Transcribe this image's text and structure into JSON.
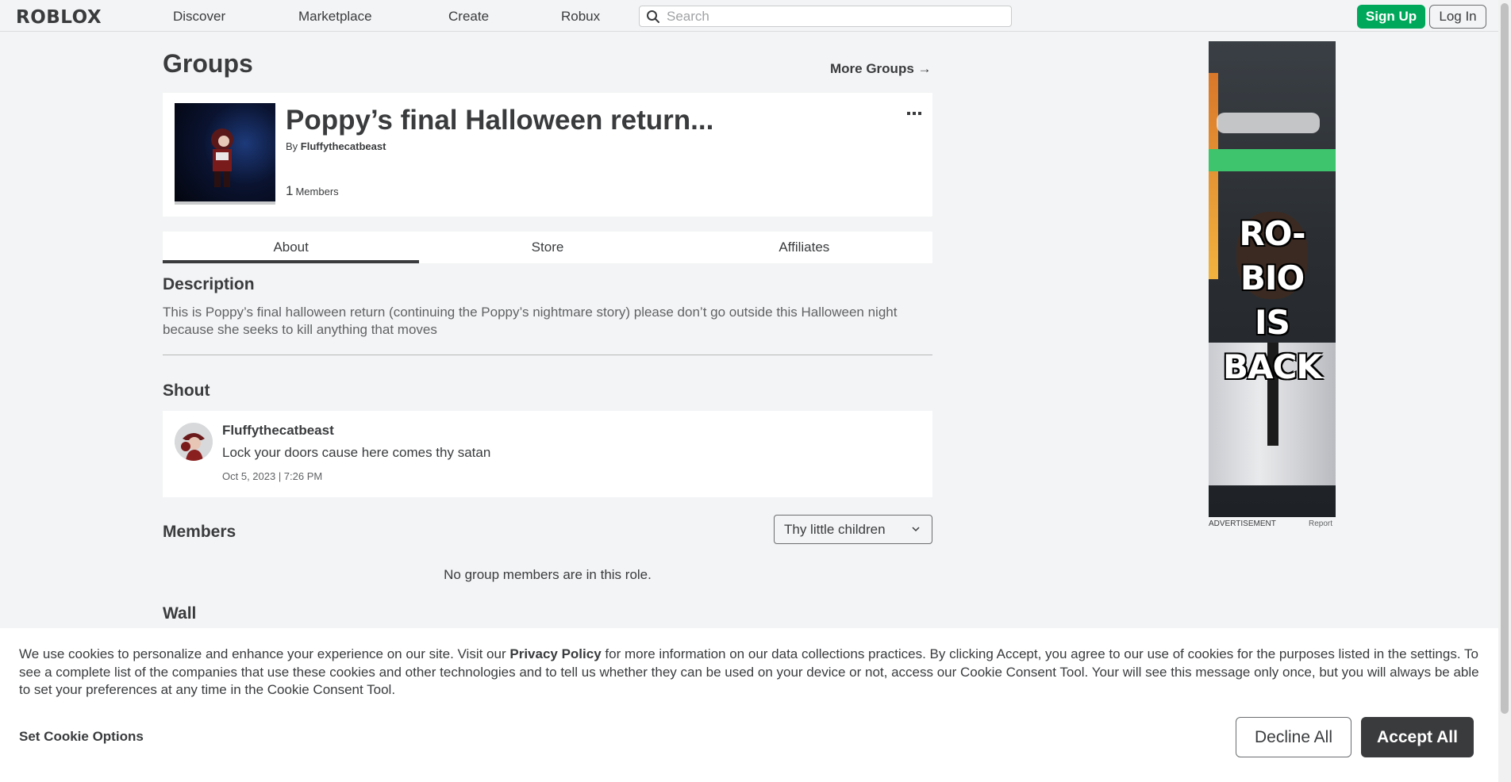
{
  "header": {
    "logo": "RΟBLOX",
    "nav": [
      "Discover",
      "Marketplace",
      "Create",
      "Robux"
    ],
    "search_placeholder": "Search",
    "signup_label": "Sign Up",
    "login_label": "Log In"
  },
  "page": {
    "title": "Groups",
    "more_groups": "More Groups →"
  },
  "group": {
    "name": "Poppy’s final Halloween return...",
    "by_prefix": "By",
    "owner": "Fluffythecatbeast",
    "member_count": "1",
    "member_label": "Members"
  },
  "tabs": [
    {
      "label": "About",
      "active": true
    },
    {
      "label": "Store",
      "active": false
    },
    {
      "label": "Affiliates",
      "active": false
    }
  ],
  "about": {
    "description_heading": "Description",
    "description": "This is Poppy’s final halloween return (continuing the Poppy’s nightmare story) please don’t go outside this Halloween night because she seeks to kill anything that moves",
    "shout_heading": "Shout",
    "shout": {
      "user": "Fluffythecatbeast",
      "text": "Lock your doors cause here comes thy satan",
      "time": "Oct 5, 2023 | 7:26 PM"
    },
    "members_heading": "Members",
    "role_selected": "Thy little children",
    "no_members": "No group members are in this role.",
    "wall_heading": "Wall"
  },
  "ad": {
    "headline_lines": [
      "RO-BIO",
      "IS",
      "BACK"
    ],
    "label": "ADVERTISEMENT",
    "report": "Report"
  },
  "cookie": {
    "text_before_link": "We use cookies to personalize and enhance your experience on our site. Visit our ",
    "link": "Privacy Policy",
    "text_after_link": " for more information on our data collections practices. By clicking Accept, you agree to our use of cookies for the purposes listed in the settings. To see a complete list of the companies that use these cookies and other technologies and to tell us whether they can be used on your device or not, access our Cookie Consent Tool. Your will see this message only once, but you will always be able to set your preferences at any time in the Cookie Consent Tool.",
    "options_label": "Set Cookie Options",
    "decline_label": "Decline All",
    "accept_label": "Accept All"
  },
  "colors": {
    "signup_green": "#00a85b",
    "text": "#393b3d",
    "page_bg": "#f2f4f5"
  }
}
